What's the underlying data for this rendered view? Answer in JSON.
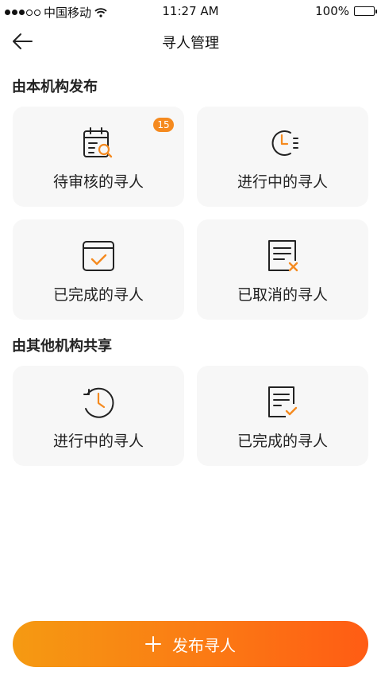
{
  "status_bar": {
    "carrier": "中国移动",
    "time": "11:27 AM",
    "battery": "100%"
  },
  "nav": {
    "title": "寻人管理"
  },
  "sections": [
    {
      "title": "由本机构发布",
      "cards": [
        {
          "label": "待审核的寻人",
          "icon": "calendar-search-icon",
          "badge": "15"
        },
        {
          "label": "进行中的寻人",
          "icon": "clock-list-icon"
        },
        {
          "label": "已完成的寻人",
          "icon": "calendar-check-icon"
        },
        {
          "label": "已取消的寻人",
          "icon": "document-cancel-icon"
        }
      ]
    },
    {
      "title": "由其他机构共享",
      "cards": [
        {
          "label": "进行中的寻人",
          "icon": "clock-history-icon"
        },
        {
          "label": "已完成的寻人",
          "icon": "document-check-icon"
        }
      ]
    }
  ],
  "publish_button": {
    "label": "发布寻人"
  },
  "colors": {
    "accent": "#f58a1f",
    "gradient_start": "#f59a12",
    "gradient_end": "#ff5c14",
    "card_bg": "#f7f7f7"
  }
}
